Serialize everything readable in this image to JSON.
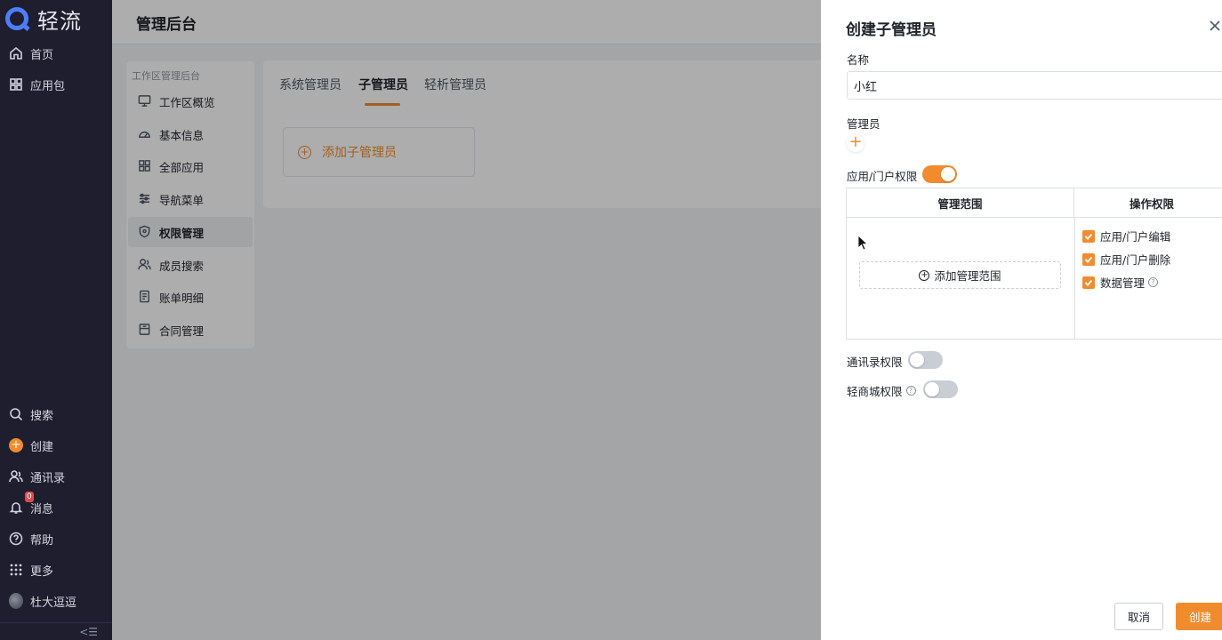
{
  "app": {
    "logo_text": "轻流"
  },
  "nav": {
    "top_items": [
      {
        "label": "首页",
        "icon": "home-icon"
      },
      {
        "label": "应用包",
        "icon": "grid-icon"
      }
    ],
    "bottom_items": [
      {
        "label": "搜索",
        "icon": "search-icon"
      },
      {
        "label": "创建",
        "icon": "create-icon"
      },
      {
        "label": "通讯录",
        "icon": "contacts-icon"
      },
      {
        "label": "消息",
        "icon": "bell-icon",
        "badge": "0"
      },
      {
        "label": "帮助",
        "icon": "help-icon"
      },
      {
        "label": "更多",
        "icon": "more-icon"
      },
      {
        "label": "杜大逗逗",
        "icon": "avatar"
      }
    ],
    "collapse_glyph": "<☰"
  },
  "page": {
    "title": "管理后台"
  },
  "sub_nav": {
    "heading": "工作区管理后台",
    "items": [
      {
        "label": "工作区概览",
        "icon": "monitor-icon"
      },
      {
        "label": "基本信息",
        "icon": "gauge-icon"
      },
      {
        "label": "全部应用",
        "icon": "apps-icon"
      },
      {
        "label": "导航菜单",
        "icon": "sliders-icon"
      },
      {
        "label": "权限管理",
        "icon": "shield-icon",
        "active": true
      },
      {
        "label": "成员搜索",
        "icon": "users-icon"
      },
      {
        "label": "账单明细",
        "icon": "bill-icon"
      },
      {
        "label": "合同管理",
        "icon": "contract-icon"
      }
    ]
  },
  "tabs": [
    {
      "label": "系统管理员"
    },
    {
      "label": "子管理员",
      "active": true
    },
    {
      "label": "轻析管理员"
    }
  ],
  "add_sub_admin_label": "添加子管理员",
  "drawer": {
    "title": "创建子管理员",
    "name_label": "名称",
    "name_value": "小红",
    "admin_label": "管理员",
    "app_perm_label": "应用/门户权限",
    "app_perm_enabled": true,
    "table": {
      "scope_header": "管理范围",
      "ops_header": "操作权限",
      "add_scope_label": "添加管理范围",
      "ops": [
        {
          "label": "应用/门户编辑",
          "checked": true
        },
        {
          "label": "应用/门户删除",
          "checked": true
        },
        {
          "label": "数据管理",
          "checked": true,
          "help": true
        }
      ]
    },
    "contacts_perm_label": "通讯录权限",
    "contacts_perm_enabled": false,
    "mall_perm_label": "轻商城权限",
    "mall_perm_enabled": false,
    "help_glyph": "?",
    "cancel_label": "取消",
    "create_label": "创建"
  },
  "colors": {
    "accent": "#f08c2e",
    "nav_bg": "#1e1e2f"
  }
}
